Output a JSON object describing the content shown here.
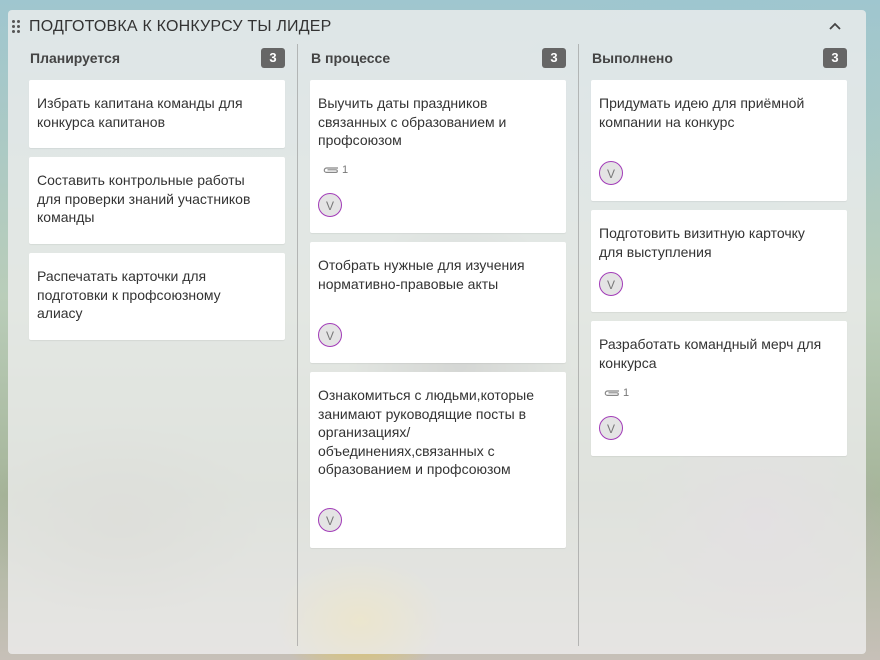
{
  "board": {
    "title": "ПОДГОТОВКА К КОНКУРСУ ТЫ ЛИДЕР"
  },
  "columns": [
    {
      "title": "Планируется",
      "count": "3",
      "cards": [
        {
          "text": "Избрать капитана команды для конкурса капитанов"
        },
        {
          "text": "Составить контрольные работы для проверки знаний участников команды"
        },
        {
          "text": "Распечатать карточки для подготовки к профсоюзному алиасу"
        }
      ]
    },
    {
      "title": "В процессе",
      "count": "3",
      "cards": [
        {
          "text": "Выучить даты праздников связанных с образованием и профсоюзом",
          "attachments": "1",
          "assignee": "V"
        },
        {
          "text": "Отобрать нужные для изучения нормативно-правовые акты",
          "assignee": "V"
        },
        {
          "text": "Ознакомиться с людьми,которые занимают руководящие посты в организациях/объединениях,связанных с образованием и профсоюзом",
          "assignee": "V"
        }
      ]
    },
    {
      "title": "Выполнено",
      "count": "3",
      "cards": [
        {
          "text": "Придумать идею для приёмной компании на конкурс",
          "assignee": "V"
        },
        {
          "text": "Подготовить визитную карточку для выступления",
          "assignee": "V"
        },
        {
          "text": "Разработать командный мерч для конкурса",
          "attachments": "1",
          "assignee": "V"
        }
      ]
    }
  ],
  "icons": {
    "drag": "drag-handle-icon",
    "collapse": "chevron-up-icon",
    "attachment": "paperclip-icon"
  },
  "colors": {
    "count_badge": "#666666",
    "avatar_border": "#a23cb8"
  }
}
